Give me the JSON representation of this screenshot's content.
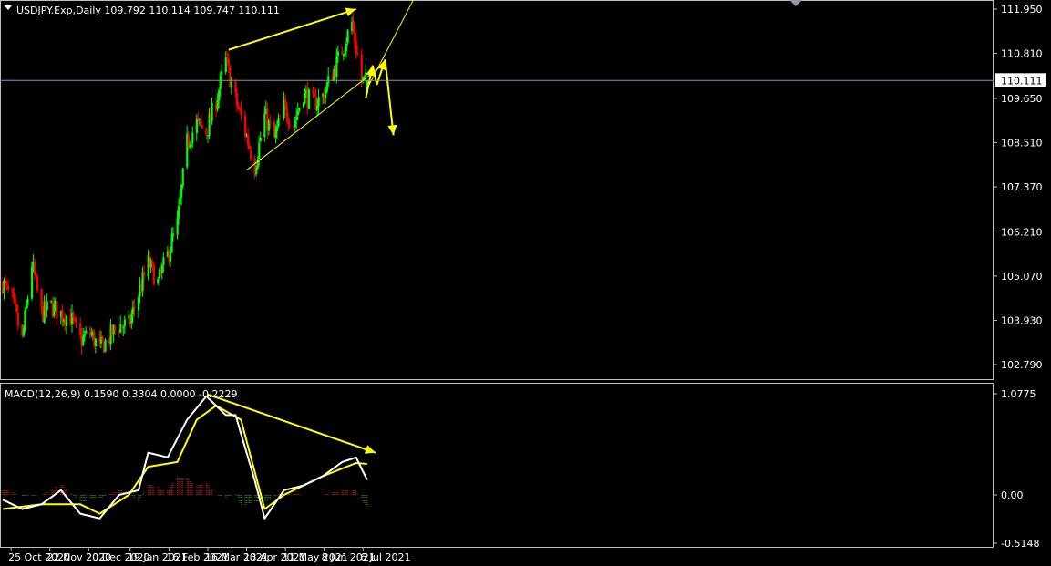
{
  "header": {
    "symbol_line": "USDJPY.Exp,Daily  109.792 110.114 109.747 110.111",
    "macd_line": "MACD(12,26,9) 0.1590 0.3304 0.0000 -0.2229"
  },
  "price_axis": {
    "ticks": [
      "111.950",
      "110.810",
      "109.650",
      "108.510",
      "107.370",
      "106.210",
      "105.070",
      "103.930",
      "102.790"
    ],
    "current_price": "110.111"
  },
  "macd_axis": {
    "ticks": [
      "1.0775",
      "0.00",
      "-0.5148"
    ]
  },
  "time_axis": {
    "labels": [
      "25 Oct 2020",
      "22 Nov 2020",
      "20 Dec 2020",
      "19 Jan 2021",
      "16 Feb 2021",
      "16 Mar 2021",
      "13 Apr 2021",
      "11 May 2021",
      "8 Jun 2021",
      "6 Jul 2021"
    ]
  },
  "colors": {
    "bull": "#00ff00",
    "bear": "#ff0000",
    "annotation": "#ffff00",
    "macd_main": "#ffffff",
    "macd_signal": "#ffff00",
    "hist_pos": "#b22222",
    "hist_neg": "#228b22",
    "frame": "#c0c0c0",
    "price_line": "#8a8fa8"
  },
  "chart_data": [
    {
      "type": "candlestick",
      "title": "USDJPY.Exp,Daily",
      "ylim": [
        102.5,
        112.3
      ],
      "last_bar": {
        "open": 109.792,
        "high": 110.114,
        "low": 109.747,
        "close": 110.111
      },
      "waypoints": [
        {
          "date": "2020-10-19",
          "close": 104.9
        },
        {
          "date": "2020-10-26",
          "close": 104.4
        },
        {
          "date": "2020-11-02",
          "close": 103.4
        },
        {
          "date": "2020-11-09",
          "close": 105.4
        },
        {
          "date": "2020-11-16",
          "close": 104.1
        },
        {
          "date": "2020-11-23",
          "close": 104.3
        },
        {
          "date": "2020-11-30",
          "close": 104.1
        },
        {
          "date": "2020-12-07",
          "close": 104.0
        },
        {
          "date": "2020-12-14",
          "close": 103.4
        },
        {
          "date": "2020-12-21",
          "close": 103.6
        },
        {
          "date": "2020-12-28",
          "close": 103.2
        },
        {
          "date": "2021-01-04",
          "close": 103.5
        },
        {
          "date": "2021-01-11",
          "close": 103.8
        },
        {
          "date": "2021-01-18",
          "close": 103.8
        },
        {
          "date": "2021-01-25",
          "close": 104.6
        },
        {
          "date": "2021-02-01",
          "close": 105.4
        },
        {
          "date": "2021-02-08",
          "close": 104.9
        },
        {
          "date": "2021-02-15",
          "close": 105.6
        },
        {
          "date": "2021-02-22",
          "close": 106.4
        },
        {
          "date": "2021-03-01",
          "close": 108.5
        },
        {
          "date": "2021-03-08",
          "close": 109.0
        },
        {
          "date": "2021-03-15",
          "close": 108.8
        },
        {
          "date": "2021-03-22",
          "close": 109.6
        },
        {
          "date": "2021-03-29",
          "close": 110.6
        },
        {
          "date": "2021-04-05",
          "close": 109.6
        },
        {
          "date": "2021-04-12",
          "close": 108.8
        },
        {
          "date": "2021-04-19",
          "close": 107.9
        },
        {
          "date": "2021-04-26",
          "close": 109.2
        },
        {
          "date": "2021-05-03",
          "close": 108.6
        },
        {
          "date": "2021-05-10",
          "close": 109.4
        },
        {
          "date": "2021-05-17",
          "close": 109.0
        },
        {
          "date": "2021-05-24",
          "close": 109.8
        },
        {
          "date": "2021-05-31",
          "close": 109.5
        },
        {
          "date": "2021-06-07",
          "close": 109.7
        },
        {
          "date": "2021-06-14",
          "close": 110.3
        },
        {
          "date": "2021-06-21",
          "close": 110.9
        },
        {
          "date": "2021-06-28",
          "close": 111.6
        },
        {
          "date": "2021-07-05",
          "close": 110.1
        },
        {
          "date": "2021-07-09",
          "close": 110.1
        }
      ],
      "annotations": [
        {
          "kind": "trendline",
          "color": "#ffff00",
          "p1": {
            "date": "2021-03-31",
            "price": 110.9
          },
          "p2": {
            "date": "2021-07-01",
            "price": 111.95
          }
        },
        {
          "kind": "trendline",
          "color": "#ffff00",
          "p1": {
            "date": "2021-04-13",
            "price": 107.8
          },
          "p2": {
            "date": "2021-07-20",
            "price": 110.5
          }
        },
        {
          "kind": "trendline",
          "color": "#ffff00",
          "p1": {
            "date": "2021-07-09",
            "price": 109.9
          },
          "p2": {
            "date": "2021-08-13",
            "price": 112.3
          }
        },
        {
          "kind": "projection",
          "color": "#ffff00",
          "points": [
            {
              "date": "2021-07-08",
              "price": 109.65
            },
            {
              "date": "2021-07-13",
              "price": 110.5
            },
            {
              "date": "2021-07-16",
              "price": 110.0
            },
            {
              "date": "2021-07-22",
              "price": 110.65
            },
            {
              "date": "2021-07-28",
              "price": 108.7
            }
          ]
        }
      ]
    },
    {
      "type": "macd",
      "title": "MACD(12,26,9)",
      "ylim": [
        -0.6,
        1.12
      ],
      "main": [
        {
          "date": "2020-10-19",
          "value": -0.05
        },
        {
          "date": "2020-11-02",
          "value": -0.15
        },
        {
          "date": "2020-11-16",
          "value": -0.1
        },
        {
          "date": "2020-11-30",
          "value": 0.05
        },
        {
          "date": "2020-12-14",
          "value": -0.2
        },
        {
          "date": "2020-12-28",
          "value": -0.25
        },
        {
          "date": "2021-01-11",
          "value": 0.0
        },
        {
          "date": "2021-01-25",
          "value": 0.05
        },
        {
          "date": "2021-02-01",
          "value": 0.45
        },
        {
          "date": "2021-02-15",
          "value": 0.4
        },
        {
          "date": "2021-03-01",
          "value": 0.8
        },
        {
          "date": "2021-03-15",
          "value": 1.05
        },
        {
          "date": "2021-03-29",
          "value": 0.85
        },
        {
          "date": "2021-04-05",
          "value": 0.85
        },
        {
          "date": "2021-04-19",
          "value": 0.15
        },
        {
          "date": "2021-04-26",
          "value": -0.25
        },
        {
          "date": "2021-05-10",
          "value": 0.05
        },
        {
          "date": "2021-05-24",
          "value": 0.1
        },
        {
          "date": "2021-06-07",
          "value": 0.2
        },
        {
          "date": "2021-06-21",
          "value": 0.35
        },
        {
          "date": "2021-07-01",
          "value": 0.4
        },
        {
          "date": "2021-07-09",
          "value": 0.16
        }
      ],
      "signal": [
        {
          "date": "2020-10-19",
          "value": -0.15
        },
        {
          "date": "2020-11-16",
          "value": -0.1
        },
        {
          "date": "2020-12-14",
          "value": -0.1
        },
        {
          "date": "2020-12-28",
          "value": -0.2
        },
        {
          "date": "2021-01-18",
          "value": 0.0
        },
        {
          "date": "2021-02-01",
          "value": 0.3
        },
        {
          "date": "2021-02-22",
          "value": 0.35
        },
        {
          "date": "2021-03-08",
          "value": 0.8
        },
        {
          "date": "2021-03-22",
          "value": 0.95
        },
        {
          "date": "2021-04-09",
          "value": 0.8
        },
        {
          "date": "2021-04-26",
          "value": -0.15
        },
        {
          "date": "2021-05-10",
          "value": 0.0
        },
        {
          "date": "2021-06-07",
          "value": 0.2
        },
        {
          "date": "2021-07-01",
          "value": 0.34
        },
        {
          "date": "2021-07-09",
          "value": 0.33
        }
      ],
      "annotations": [
        {
          "kind": "arrow",
          "color": "#ffff00",
          "p1": {
            "date": "2021-03-16",
            "value": 1.07
          },
          "p2": {
            "date": "2021-07-15",
            "value": 0.45
          }
        }
      ]
    }
  ]
}
